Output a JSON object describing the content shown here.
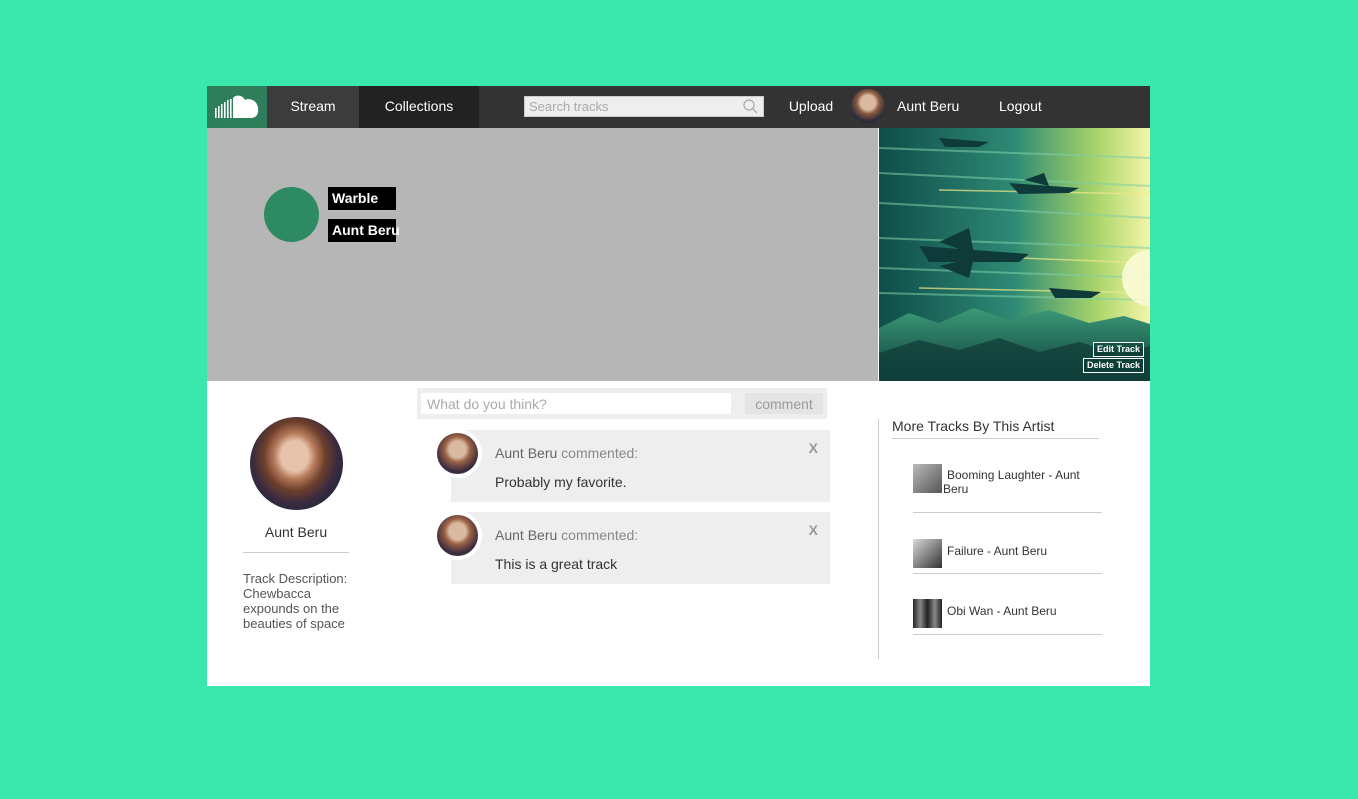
{
  "nav": {
    "stream": "Stream",
    "collections": "Collections",
    "search_placeholder": "Search tracks",
    "upload": "Upload",
    "user": "Aunt Beru",
    "logout": "Logout"
  },
  "hero": {
    "title": "Warble",
    "artist": "Aunt Beru",
    "edit_track": "Edit Track",
    "delete_track": "Delete Track"
  },
  "profile": {
    "name": "Aunt Beru",
    "description": "Track Description: Chewbacca expounds on the beauties of space"
  },
  "comment_form": {
    "placeholder": "What do you think?",
    "button": "comment"
  },
  "comments": [
    {
      "author": "Aunt Beru",
      "action": "commented:",
      "body": "Probably my favorite.",
      "close": "X"
    },
    {
      "author": "Aunt Beru",
      "action": "commented:",
      "body": "This is a great track",
      "close": "X"
    }
  ],
  "sidebar": {
    "title": "More Tracks By This Artist",
    "tracks": [
      {
        "title": "Booming Laughter",
        "artist": "Aunt Beru",
        "line1": "Booming Laughter  -  Aunt",
        "line2": "Beru"
      },
      {
        "title": "Failure",
        "artist": "Aunt Beru",
        "line1": "Failure  -  Aunt Beru",
        "line2": ""
      },
      {
        "title": "Obi Wan",
        "artist": "Aunt Beru",
        "line1": "Obi Wan  -  Aunt Beru",
        "line2": ""
      }
    ]
  },
  "icons": {
    "logo": "soundcloud-cloud-icon",
    "search": "search-icon"
  },
  "colors": {
    "background": "#3ae8ad",
    "nav": "#333333",
    "accent": "#2e8a63"
  }
}
